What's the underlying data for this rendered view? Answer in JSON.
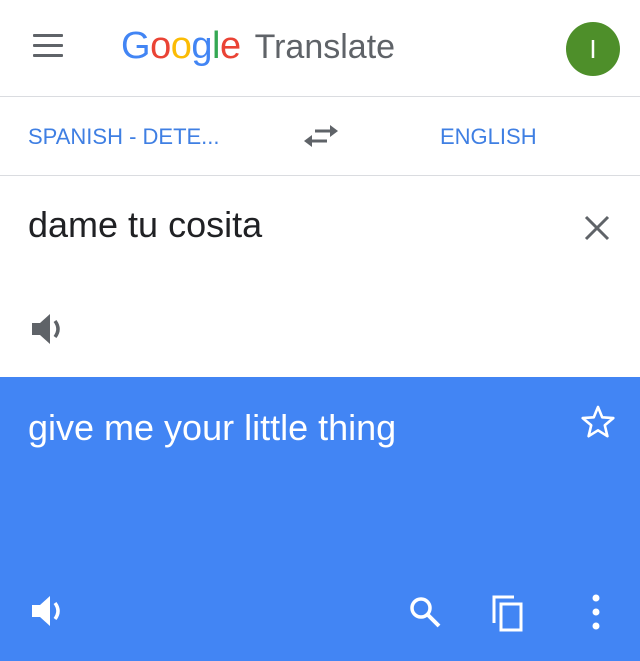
{
  "app": {
    "logo": {
      "letters": [
        {
          "char": "G",
          "color": "#4285f4"
        },
        {
          "char": "o",
          "color": "#ea4335"
        },
        {
          "char": "o",
          "color": "#fbbc05"
        },
        {
          "char": "g",
          "color": "#4285f4"
        },
        {
          "char": "l",
          "color": "#34a853"
        },
        {
          "char": "e",
          "color": "#ea4335"
        }
      ],
      "product": "Translate"
    },
    "avatar_initial": "I"
  },
  "languages": {
    "source": "SPANISH - DETE...",
    "target": "ENGLISH"
  },
  "input": {
    "text": "dame tu cosita"
  },
  "output": {
    "text": "give me your little thing"
  },
  "icons": {
    "menu": "menu-icon",
    "swap": "swap-languages-icon",
    "clear": "close-icon",
    "listen_source": "speaker-icon",
    "star": "star-icon",
    "listen_output": "speaker-icon",
    "search": "search-icon",
    "copy": "copy-icon",
    "more": "more-vert-icon"
  },
  "colors": {
    "accent": "#3f7fe3",
    "output_bg": "#4285f4",
    "avatar": "#4e8f2a"
  }
}
